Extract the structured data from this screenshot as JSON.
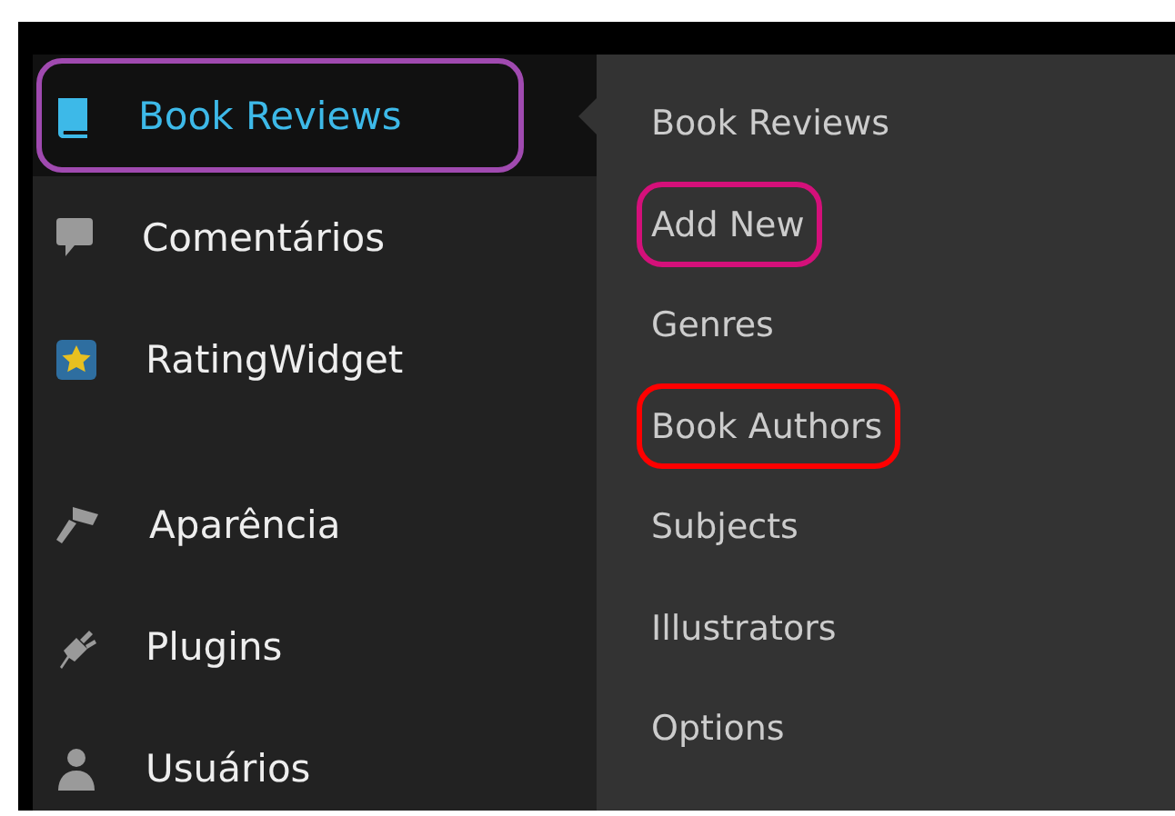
{
  "sidebar": {
    "items": [
      {
        "label": "Book Reviews",
        "selected": true,
        "gap_before": false,
        "color": "#a04ab0"
      },
      {
        "label": "Comentários",
        "selected": false,
        "gap_before": false
      },
      {
        "label": "RatingWidget",
        "selected": false,
        "gap_before": false
      },
      {
        "label": "Aparência",
        "selected": false,
        "gap_before": true
      },
      {
        "label": "Plugins",
        "selected": false,
        "gap_before": false
      },
      {
        "label": "Usuários",
        "selected": false,
        "gap_before": false
      }
    ]
  },
  "submenu": {
    "items": [
      {
        "label": "Book Reviews"
      },
      {
        "label": "Add New",
        "color": "#d4107a"
      },
      {
        "label": "Genres"
      },
      {
        "label": "Book Authors",
        "color": "#ff0000"
      },
      {
        "label": "Subjects"
      },
      {
        "label": "Illustrators"
      },
      {
        "label": "Options"
      }
    ]
  }
}
